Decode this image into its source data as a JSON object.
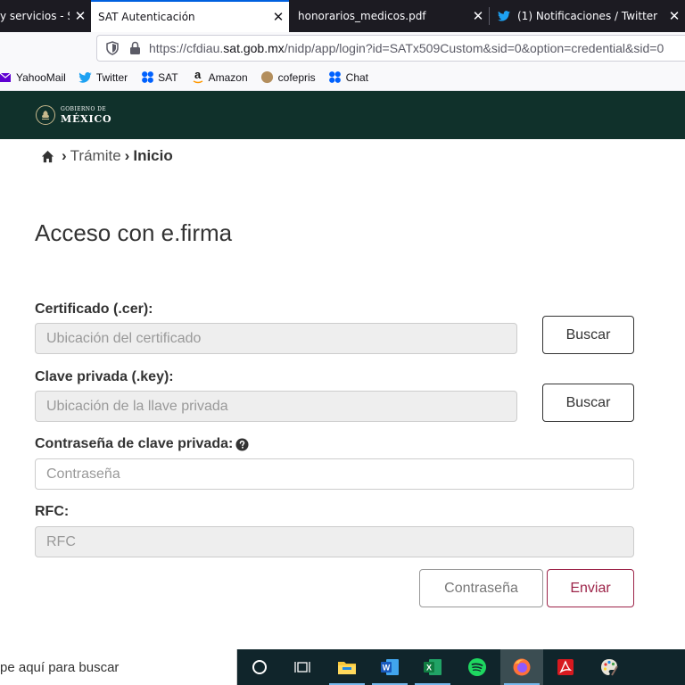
{
  "browser": {
    "tabs": [
      {
        "label": "y servicios - S",
        "active": false
      },
      {
        "label": "SAT Autenticación",
        "active": true
      },
      {
        "label": "honorarios_medicos.pdf",
        "active": false
      },
      {
        "label": "(1) Notificaciones / Twitter",
        "active": false
      }
    ],
    "close_glyph": "✕",
    "url": {
      "prefix": "https://cfdiau.",
      "host": "sat.gob.mx",
      "path": "/nidp/app/login?id=SATx509Custom&sid=0&option=credential&sid=0"
    },
    "bookmarks": [
      {
        "label": "YahooMail",
        "icon": "yahoo-mail-icon"
      },
      {
        "label": "Twitter",
        "icon": "twitter-icon"
      },
      {
        "label": "SAT",
        "icon": "butterfly-icon"
      },
      {
        "label": "Amazon",
        "icon": "amazon-icon"
      },
      {
        "label": "cofepris",
        "icon": "circle-icon"
      },
      {
        "label": "Chat",
        "icon": "butterfly-icon"
      }
    ]
  },
  "header": {
    "logo_small": "GOBIERNO DE",
    "logo_big": "MÉXICO"
  },
  "breadcrumb": {
    "items": [
      "Trámite",
      "Inicio"
    ]
  },
  "form": {
    "title": "Acceso con e.firma",
    "cert_label": "Certificado (.cer):",
    "cert_placeholder": "Ubicación del certificado",
    "key_label": "Clave privada (.key):",
    "key_placeholder": "Ubicación de la llave privada",
    "password_label": "Contraseña de clave privada:",
    "password_placeholder": "Contraseña",
    "rfc_label": "RFC:",
    "rfc_placeholder": "RFC",
    "browse_label": "Buscar",
    "password_button": "Contraseña",
    "submit_button": "Enviar"
  },
  "taskbar": {
    "search_text": "pe aquí para buscar",
    "apps": [
      "cortana-icon",
      "task-view-icon",
      "file-explorer-icon",
      "word-icon",
      "excel-icon",
      "spotify-icon",
      "firefox-icon",
      "acrobat-icon",
      "paint-icon"
    ]
  },
  "colors": {
    "gob_green": "#10312b",
    "primary": "#9d2449",
    "firefox_tab_dark": "#1c1b22"
  }
}
